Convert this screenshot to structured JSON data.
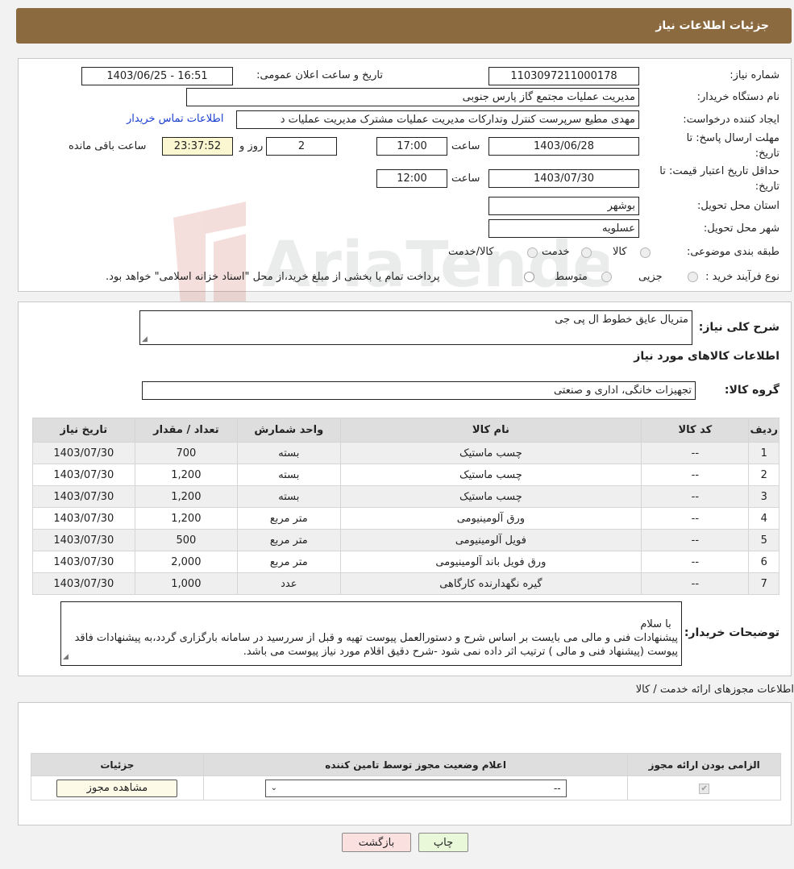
{
  "header": {
    "title": "جزئیات اطلاعات نیاز"
  },
  "watermark": {
    "text": "AriaTender.neT"
  },
  "form": {
    "need_number_label": "شماره نیاز:",
    "need_number": "1103097211000178",
    "announce_label": "تاریخ و ساعت اعلان عمومی:",
    "announce_value": "1403/06/25 - 16:51",
    "buyer_label": "نام دستگاه خریدار:",
    "buyer_value": "مدیریت عملیات مجتمع گاز پارس جنوبی",
    "creator_label": "ایجاد کننده درخواست:",
    "creator_value": "مهدی مطیع سرپرست کنترل وتدارکات مدیریت عملیات مشترک مدیریت عملیات د",
    "contact_link": "اطلاعات تماس خریدار",
    "deadline_label_1": "مهلت ارسال پاسخ: تا",
    "deadline_label_2": "تاریخ:",
    "deadline_date": "1403/06/28",
    "time_label": "ساعت",
    "deadline_time": "17:00",
    "days_value": "2",
    "days_label": "روز و",
    "remaining_value": "23:37:52",
    "remaining_label": "ساعت باقی مانده",
    "validity_label_1": "حداقل تاریخ اعتبار قیمت: تا",
    "validity_label_2": "تاریخ:",
    "validity_date": "1403/07/30",
    "validity_time": "12:00",
    "province_label": "استان محل تحویل:",
    "province_value": "بوشهر",
    "city_label": "شهر محل تحویل:",
    "city_value": "عسلویه",
    "category_label": "طبقه بندی موضوعی:",
    "category_options": [
      "کالا",
      "خدمت",
      "کالا/خدمت"
    ],
    "process_label": "نوع فرآیند خرید :",
    "process_options": [
      "جزیی",
      "متوسط"
    ],
    "process_note": "پرداخت تمام یا بخشی از مبلغ خرید،از محل \"اسناد خزانه اسلامی\" خواهد بود."
  },
  "summary": {
    "label": "شرح کلی نیاز:",
    "value": "متریال عایق خطوط ال پی جی",
    "goods_heading": "اطلاعات کالاهای مورد نیاز",
    "group_label": "گروه کالا:",
    "group_value": "تجهیزات خانگی، اداری و صنعتی"
  },
  "items_table": {
    "headers": [
      "ردیف",
      "کد کالا",
      "نام کالا",
      "واحد شمارش",
      "تعداد / مقدار",
      "تاریخ نیاز"
    ],
    "rows": [
      [
        "1",
        "--",
        "چسب ماستیک",
        "بسته",
        "700",
        "1403/07/30"
      ],
      [
        "2",
        "--",
        "چسب ماستیک",
        "بسته",
        "1,200",
        "1403/07/30"
      ],
      [
        "3",
        "--",
        "چسب ماستیک",
        "بسته",
        "1,200",
        "1403/07/30"
      ],
      [
        "4",
        "--",
        "ورق آلومینیومی",
        "متر مربع",
        "1,200",
        "1403/07/30"
      ],
      [
        "5",
        "--",
        "فویل آلومینیومی",
        "متر مربع",
        "500",
        "1403/07/30"
      ],
      [
        "6",
        "--",
        "ورق فویل باند آلومینیومی",
        "متر مربع",
        "2,000",
        "1403/07/30"
      ],
      [
        "7",
        "--",
        "گیره نگهدارنده کارگاهی",
        "عدد",
        "1,000",
        "1403/07/30"
      ]
    ]
  },
  "buyer_notes": {
    "label": "توضیحات خریدار:",
    "text": "با سلام\nپیشنهادات فنی و مالی می بایست بر اساس شرح و دستورالعمل پیوست تهیه و قبل از سررسید در سامانه بارگزاری گردد،به پیشنهادات فاقد پیوست (پیشنهاد فنی و مالی ) ترتیب اثر داده نمی شود -شرح دقیق اقلام مورد نیاز پیوست می باشد."
  },
  "permits": {
    "heading": "اطلاعات مجوزهای ارائه خدمت / کالا",
    "headers": [
      "الزامی بودن ارائه مجوز",
      "اعلام وضعیت مجوز توسط تامین کننده",
      "جزئیات"
    ],
    "select_value": "--",
    "view_button": "مشاهده مجوز"
  },
  "footer": {
    "print_button": "چاپ",
    "back_button": "بازگشت"
  },
  "colors": {
    "header_bg": "#8b6a3f",
    "link": "#1a3fd0",
    "print_bg": "#e8f8d8",
    "back_bg": "#fbe0e0"
  }
}
